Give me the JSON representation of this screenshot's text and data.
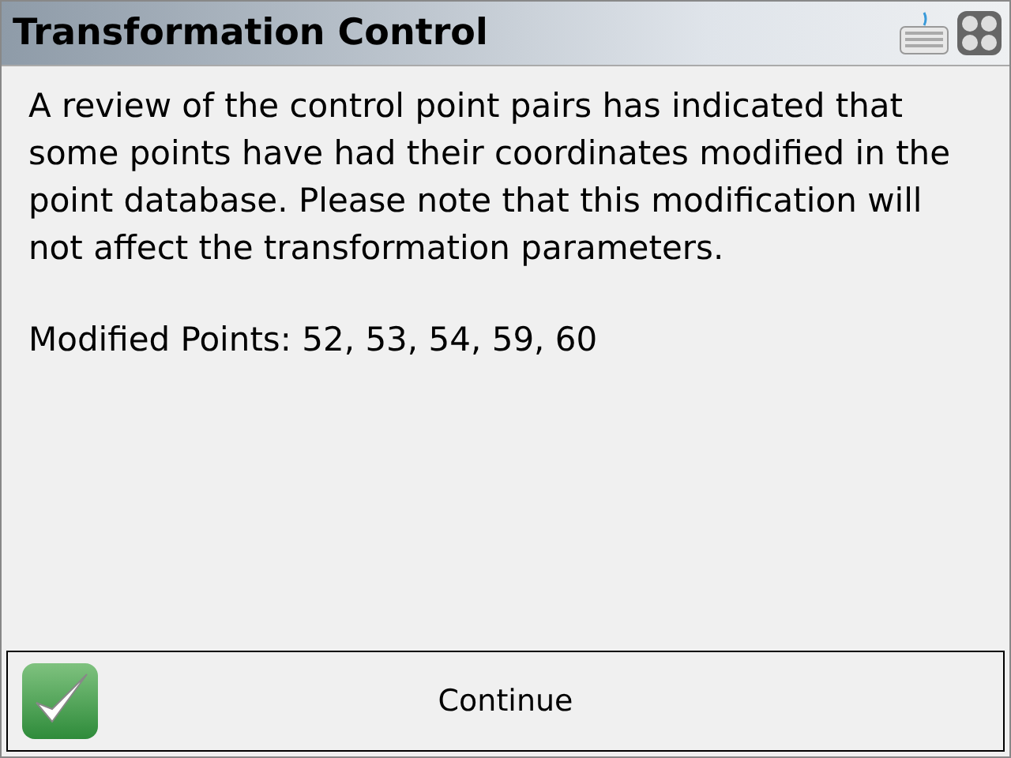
{
  "window": {
    "title": "Transformation Control"
  },
  "message": "A review of the control point pairs has indicated that some points have had their coordinates modified in the point database. Please note that this modification will not affect the transformation parameters.",
  "modified_points": "Modified Points: 52, 53, 54, 59, 60",
  "buttons": [
    {
      "label": "Continue"
    }
  ]
}
